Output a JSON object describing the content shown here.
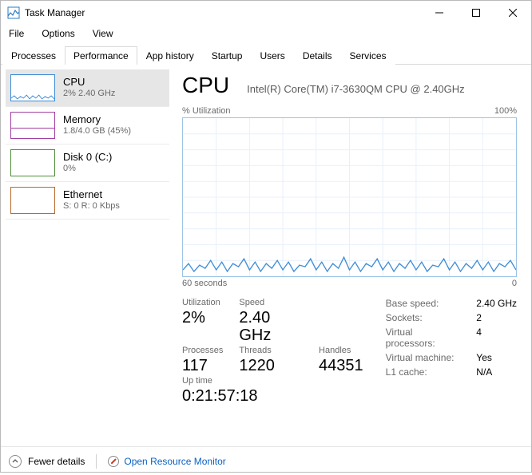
{
  "window": {
    "title": "Task Manager"
  },
  "menu": {
    "file": "File",
    "options": "Options",
    "view": "View"
  },
  "tabs": {
    "processes": "Processes",
    "performance": "Performance",
    "app_history": "App history",
    "startup": "Startup",
    "users": "Users",
    "details": "Details",
    "services": "Services"
  },
  "sidebar": {
    "cpu": {
      "title": "CPU",
      "sub": "2% 2.40 GHz"
    },
    "memory": {
      "title": "Memory",
      "sub": "1.8/4.0 GB (45%)"
    },
    "disk": {
      "title": "Disk 0 (C:)",
      "sub": "0%"
    },
    "ethernet": {
      "title": "Ethernet",
      "sub": "S: 0 R: 0 Kbps"
    }
  },
  "main": {
    "title": "CPU",
    "device": "Intel(R) Core(TM) i7-3630QM CPU @ 2.40GHz",
    "chart_top_left": "% Utilization",
    "chart_top_right": "100%",
    "chart_bottom_left": "60 seconds",
    "chart_bottom_right": "0",
    "stats_left": {
      "utilization_lbl": "Utilization",
      "utilization_val": "2%",
      "speed_lbl": "Speed",
      "speed_val": "2.40 GHz",
      "processes_lbl": "Processes",
      "processes_val": "117",
      "threads_lbl": "Threads",
      "threads_val": "1220",
      "handles_lbl": "Handles",
      "handles_val": "44351",
      "uptime_lbl": "Up time",
      "uptime_val": "0:21:57:18"
    },
    "stats_right": {
      "base_speed_k": "Base speed:",
      "base_speed_v": "2.40 GHz",
      "sockets_k": "Sockets:",
      "sockets_v": "2",
      "vprocs_k": "Virtual processors:",
      "vprocs_v": "4",
      "vm_k": "Virtual machine:",
      "vm_v": "Yes",
      "l1_k": "L1 cache:",
      "l1_v": "N/A"
    }
  },
  "footer": {
    "fewer": "Fewer details",
    "resmon": "Open Resource Monitor"
  },
  "chart_data": {
    "type": "line",
    "title": "% Utilization",
    "xlabel": "60 seconds",
    "ylabel": "% Utilization",
    "ylim": [
      0,
      100
    ],
    "x": [
      0,
      1,
      2,
      3,
      4,
      5,
      6,
      7,
      8,
      9,
      10,
      11,
      12,
      13,
      14,
      15,
      16,
      17,
      18,
      19,
      20,
      21,
      22,
      23,
      24,
      25,
      26,
      27,
      28,
      29,
      30,
      31,
      32,
      33,
      34,
      35,
      36,
      37,
      38,
      39,
      40,
      41,
      42,
      43,
      44,
      45,
      46,
      47,
      48,
      49,
      50,
      51,
      52,
      53,
      54,
      55,
      56,
      57,
      58,
      59,
      60
    ],
    "values": [
      4,
      8,
      3,
      7,
      5,
      10,
      4,
      9,
      3,
      8,
      6,
      11,
      4,
      9,
      3,
      8,
      5,
      10,
      4,
      9,
      3,
      7,
      6,
      11,
      4,
      9,
      3,
      8,
      5,
      12,
      4,
      9,
      3,
      8,
      6,
      11,
      4,
      9,
      3,
      8,
      5,
      10,
      4,
      9,
      3,
      7,
      6,
      11,
      4,
      9,
      3,
      8,
      5,
      10,
      4,
      9,
      3,
      8,
      6,
      10,
      4
    ]
  }
}
